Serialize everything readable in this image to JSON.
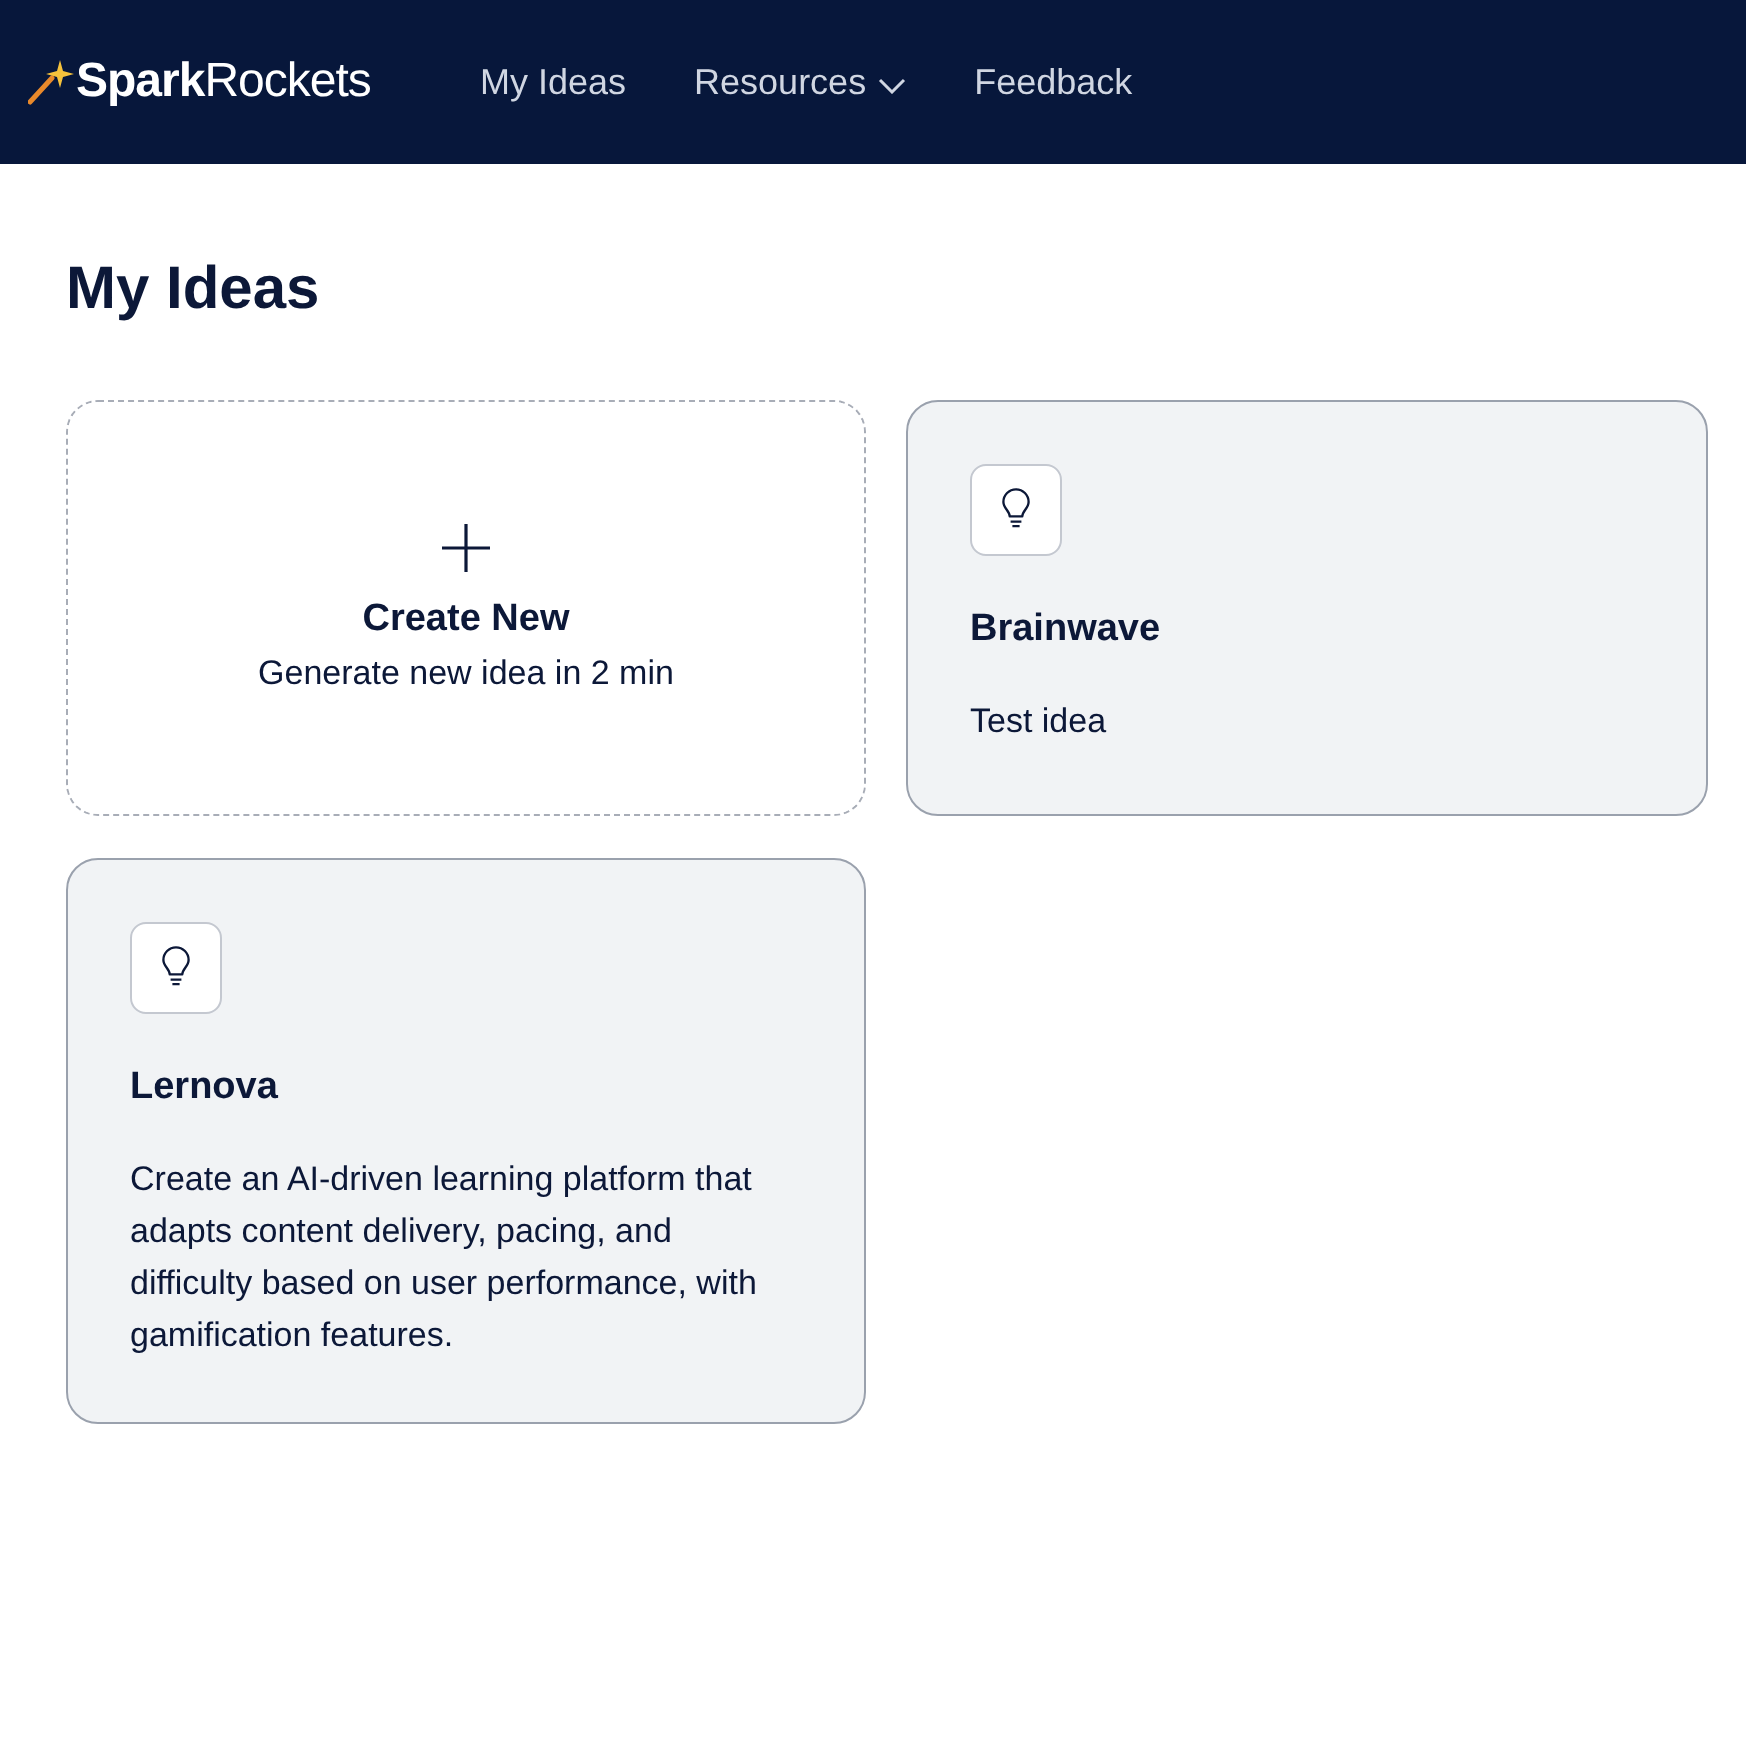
{
  "header": {
    "logo": "**Spark**Rockets",
    "nav": [
      {
        "label": "My Ideas",
        "dropdown": false
      },
      {
        "label": "Resources",
        "dropdown": true
      },
      {
        "label": "Feedback",
        "dropdown": false
      }
    ]
  },
  "page_title": "My Ideas",
  "create_card": {
    "title": "Create New",
    "subtitle": "Generate new idea in 2 min"
  },
  "ideas": [
    {
      "name": "Brainwave",
      "description": "Test idea"
    },
    {
      "name": "Lernova",
      "description": "Create an AI-driven learning platform that adapts content delivery, pacing, and difficulty based on user performance, with gamification features."
    }
  ]
}
